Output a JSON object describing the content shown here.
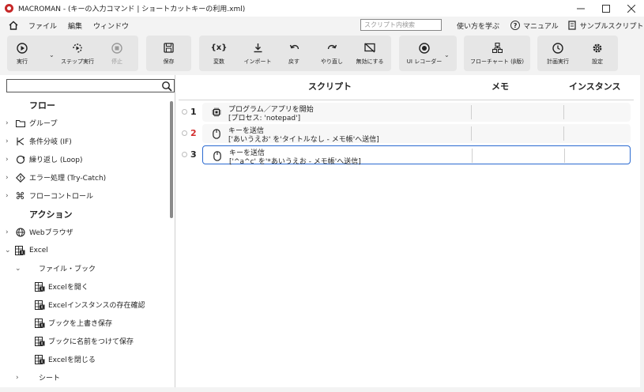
{
  "window": {
    "title": "MACROMAN - (キーの入力コマンド | ショートカットキーの利用.xml)",
    "controls": [
      "—",
      "☐",
      "✕"
    ]
  },
  "menu": {
    "items": [
      "ファイル",
      "編集",
      "ウィンドウ"
    ],
    "search_placeholder": "スクリプト内検索",
    "learn": "使い方を学ぶ",
    "manual": "マニュアル",
    "samples": "サンプルスクリプト"
  },
  "toolbar": {
    "run": "実行",
    "step_run": "ステップ実行",
    "stop": "停止",
    "save": "保存",
    "variables": "変数",
    "import": "インポート",
    "undo": "戻す",
    "redo": "やり直し",
    "disable": "無効にする",
    "ui_recorder": "UI レコーダー",
    "flowchart": "フローチャート (β版)",
    "scheduled_run": "計画実行",
    "settings": "設定"
  },
  "left_panel": {
    "search_value": "",
    "sections": {
      "flow": "フロー",
      "action": "アクション"
    },
    "flow_items": [
      "グループ",
      "条件分岐 (IF)",
      "繰り返し (Loop)",
      "エラー処理 (Try-Catch)",
      "フローコントロール"
    ],
    "action_items": {
      "web": "Webブラウザ",
      "excel": "Excel",
      "file_book": "ファイル・ブック",
      "book_items": [
        "Excelを開く",
        "Excelインスタンスの存在確認",
        "ブックを上書き保存",
        "ブックに名前をつけて保存",
        "Excelを閉じる"
      ],
      "sheet": "シート"
    }
  },
  "script": {
    "headers": {
      "script": "スクリプト",
      "memo": "メモ",
      "instance": "インスタンス"
    },
    "rows": [
      {
        "num": "1",
        "line1": "プログラム／アプリを開始",
        "line2": "[プロセス: 'notepad']",
        "memo": "",
        "instance": ""
      },
      {
        "num": "2",
        "line1": "キーを送信",
        "line2": "['あいうえお' を'タイトルなし - メモ帳'へ送信]",
        "memo": "",
        "instance": ""
      },
      {
        "num": "3",
        "line1": "キーを送信",
        "line2": "['^a^c' を'*あいうえお - メモ帳'へ送信]",
        "memo": "",
        "instance": ""
      }
    ]
  },
  "colors": {
    "accent": "#2a6ad1",
    "error_num": "#d32f2f",
    "logo": "#c62828",
    "toolbar_group": "#e6e6e6"
  }
}
